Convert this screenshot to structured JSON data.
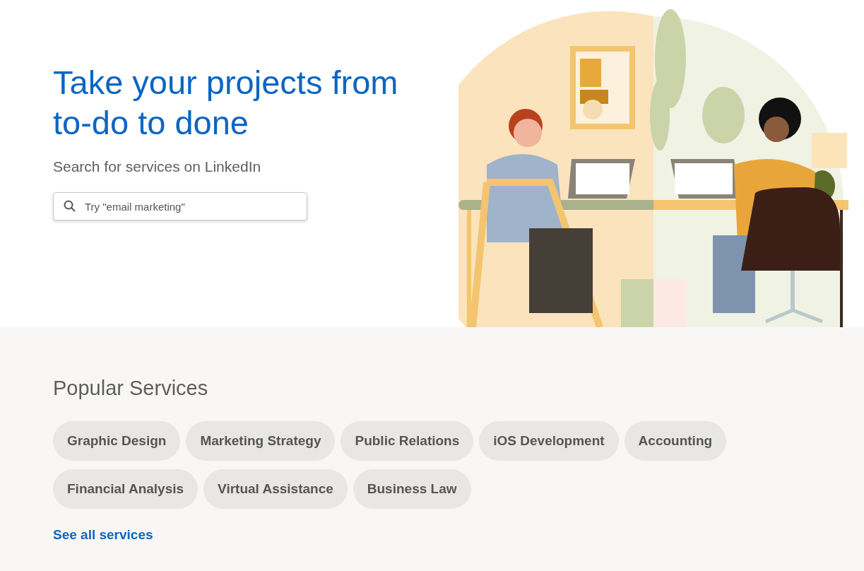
{
  "hero": {
    "title": "Take your projects from to-do to done",
    "subtitle": "Search for services on LinkedIn",
    "search": {
      "placeholder": "Try \"email marketing\""
    }
  },
  "popular": {
    "title": "Popular Services",
    "services": [
      {
        "label": "Graphic Design"
      },
      {
        "label": "Marketing Strategy"
      },
      {
        "label": "Public Relations"
      },
      {
        "label": "iOS Development"
      },
      {
        "label": "Accounting"
      },
      {
        "label": "Financial Analysis"
      },
      {
        "label": "Virtual Assistance"
      },
      {
        "label": "Business Law"
      }
    ],
    "link": "See all services"
  }
}
